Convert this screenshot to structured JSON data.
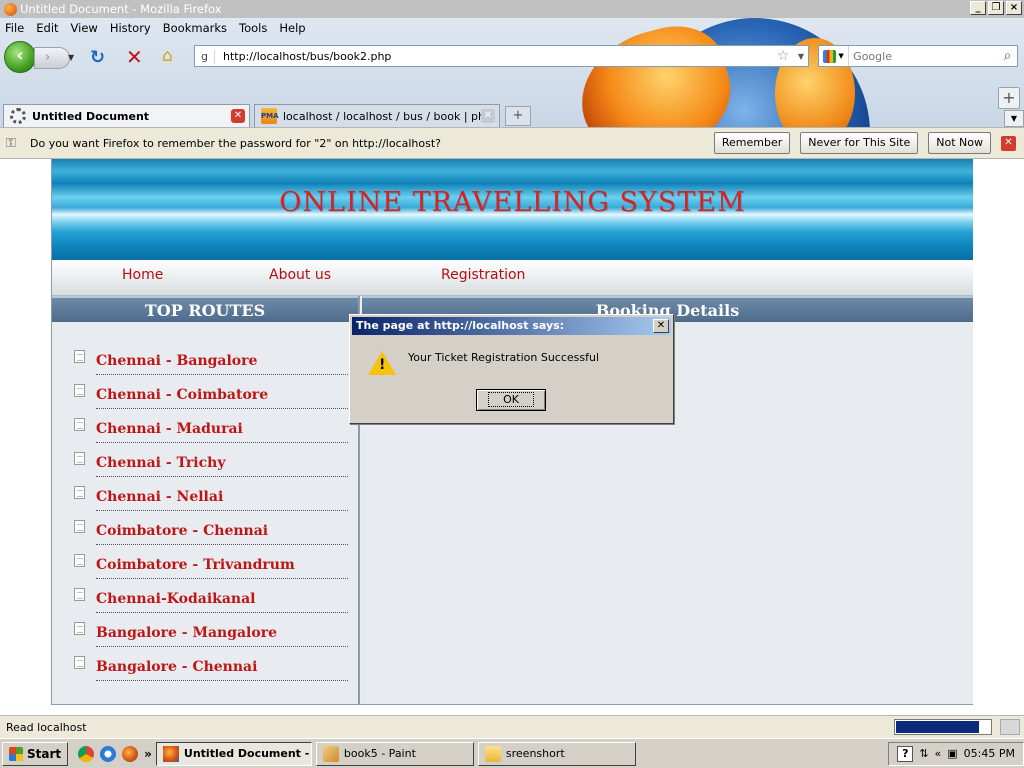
{
  "window": {
    "title": "Untitled Document - Mozilla Firefox",
    "controls": [
      "_",
      "❐",
      "×"
    ]
  },
  "menu": [
    "File",
    "Edit",
    "View",
    "History",
    "Bookmarks",
    "Tools",
    "Help"
  ],
  "navbar": {
    "url": "http://localhost/bus/book2.php",
    "url_favicon": "g",
    "search_placeholder": "Google"
  },
  "tabs": [
    {
      "label": "Untitled Document",
      "icon": "loading-spinner-icon",
      "active": true
    },
    {
      "label": "localhost / localhost / bus / book | php...",
      "icon": "phpmyadmin-icon",
      "icon_text": "PMA",
      "active": false
    }
  ],
  "notification": {
    "message": "Do you want Firefox to remember the password for \"2\" on http://localhost?",
    "buttons": [
      "Remember",
      "Never for This Site",
      "Not Now"
    ]
  },
  "site": {
    "title": "ONLINE TRAVELLING SYSTEM",
    "nav": [
      "Home",
      "About us",
      "Registration"
    ],
    "left_panel_title": "TOP ROUTES",
    "routes": [
      "Chennai - Bangalore",
      "Chennai - Coimbatore",
      "Chennai - Madurai",
      "Chennai - Trichy",
      "Chennai - Nellai",
      "Coimbatore - Chennai",
      "Coimbatore - Trivandrum",
      "Chennai-Kodaikanal",
      "Bangalore - Mangalore",
      "Bangalore - Chennai"
    ],
    "right_panel_title": "Booking Details",
    "colors": {
      "title": "#dd1f1f",
      "links": "#c01515",
      "panel_header": "#4d6c8c"
    }
  },
  "dialog": {
    "title": "The page at http://localhost says:",
    "message": "Your Ticket Registration Successful",
    "ok_label": "OK"
  },
  "statusbar": {
    "text": "Read localhost",
    "progress_fraction": 0.88
  },
  "taskbar": {
    "start_label": "Start",
    "more_label": "»",
    "tasks": [
      {
        "label": "Untitled Document - ...",
        "icon": "firefox-icon",
        "active": true
      },
      {
        "label": "book5 - Paint",
        "icon": "paint-icon",
        "active": false
      },
      {
        "label": "sreenshort",
        "icon": "folder-icon",
        "active": false
      }
    ],
    "tray_more": "«",
    "clock": "05:45 PM"
  }
}
